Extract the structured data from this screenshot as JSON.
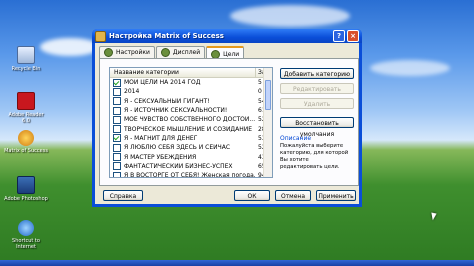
{
  "desktop": {
    "icons": [
      {
        "label": "Recycle Bin",
        "icon": "recycle-bin-icon"
      },
      {
        "label": "Adobe Reader 6.0",
        "icon": "adobe-reader-icon"
      },
      {
        "label": "Matrix of Success",
        "icon": "matrix-of-success-icon"
      },
      {
        "label": "Adobe Photoshop",
        "icon": "adobe-photoshop-icon"
      },
      {
        "label": "Shortcut to Internet",
        "icon": "internet-shortcut-icon"
      }
    ]
  },
  "window": {
    "title": "Настройка Matrix of Success",
    "tabs": [
      {
        "label": "Настройки",
        "active": false
      },
      {
        "label": "Дисплей",
        "active": false
      },
      {
        "label": "Цели",
        "active": true
      }
    ],
    "list": {
      "col_name": "Название категории",
      "col_count": "За",
      "rows": [
        {
          "name": "МОИ ЦЕЛИ НА 2014 ГОД",
          "count": "5",
          "checked": true
        },
        {
          "name": "2014",
          "count": "0",
          "checked": false
        },
        {
          "name": "Я - СЕКСУАЛЬНЫЙ ГИГАНТ!",
          "count": "54",
          "checked": false
        },
        {
          "name": "Я - ИСТОЧНИК СЕКСУАЛЬНОСТИ!",
          "count": "61",
          "checked": false
        },
        {
          "name": "МОЕ ЧУВСТВО СОБСТВЕННОГО ДОСТОИ...",
          "count": "52",
          "checked": false
        },
        {
          "name": "ТВОРЧЕСКОЕ МЫШЛЕНИЕ И СОЗИДАНИЕ",
          "count": "28",
          "checked": false
        },
        {
          "name": "Я - МАГНИТ ДЛЯ ДЕНЕГ",
          "count": "53",
          "checked": true
        },
        {
          "name": "Я ЛЮБЛЮ СЕБЯ ЗДЕСЬ И СЕЙЧАС",
          "count": "52",
          "checked": false
        },
        {
          "name": "Я МАСТЕР УБЕЖДЕНИЯ",
          "count": "43",
          "checked": false
        },
        {
          "name": "ФАНТАСТИЧЕСКИЙ БИЗНЕС-УСПЕХ",
          "count": "65",
          "checked": false
        },
        {
          "name": "Я В ВОСТОРГЕ ОТ СЕБЯ! Женская погода...",
          "count": "94",
          "checked": false
        }
      ]
    },
    "buttons": {
      "add_category": "Добавить категорию",
      "edit": "Редактировать",
      "delete": "Удалить",
      "restore_defaults": "Восстановить умолчания"
    },
    "description": {
      "title": "Описание",
      "text": "Пожалуйста выберите категорию, для которой Вы хотите редактировать цели."
    },
    "footer": {
      "help": "Справка",
      "ok": "ОК",
      "cancel": "Отмена",
      "apply": "Применить"
    }
  }
}
